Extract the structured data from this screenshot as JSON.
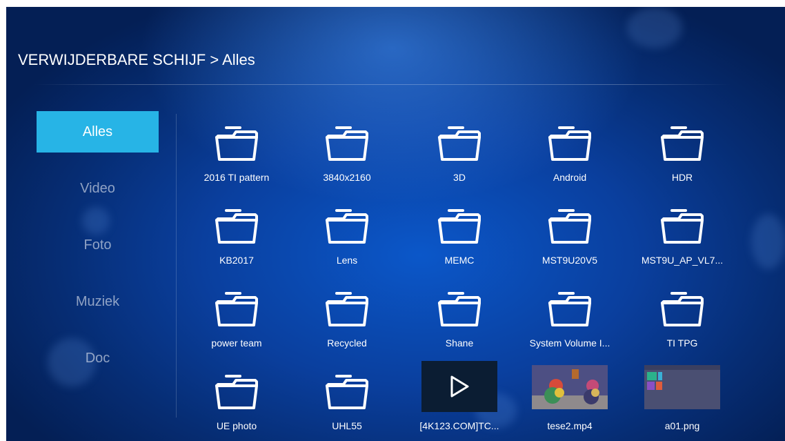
{
  "breadcrumb": {
    "source": "VERWIJDERBARE SCHIJF",
    "separator": ">",
    "current": "Alles"
  },
  "sidebar": {
    "items": [
      {
        "label": "Alles",
        "active": true
      },
      {
        "label": "Video",
        "active": false
      },
      {
        "label": "Foto",
        "active": false
      },
      {
        "label": "Muziek",
        "active": false
      },
      {
        "label": "Doc",
        "active": false
      }
    ]
  },
  "files": [
    {
      "name": "2016 TI pattern",
      "kind": "folder"
    },
    {
      "name": "3840x2160",
      "kind": "folder"
    },
    {
      "name": "3D",
      "kind": "folder"
    },
    {
      "name": "Android",
      "kind": "folder"
    },
    {
      "name": "HDR",
      "kind": "folder"
    },
    {
      "name": "KB2017",
      "kind": "folder"
    },
    {
      "name": "Lens",
      "kind": "folder"
    },
    {
      "name": "MEMC",
      "kind": "folder"
    },
    {
      "name": "MST9U20V5",
      "kind": "folder"
    },
    {
      "name": "MST9U_AP_VL7...",
      "kind": "folder"
    },
    {
      "name": "power team",
      "kind": "folder"
    },
    {
      "name": "Recycled",
      "kind": "folder"
    },
    {
      "name": "Shane",
      "kind": "folder"
    },
    {
      "name": "System Volume I...",
      "kind": "folder"
    },
    {
      "name": "TI TPG",
      "kind": "folder"
    },
    {
      "name": "UE photo",
      "kind": "folder"
    },
    {
      "name": "UHL55",
      "kind": "folder"
    },
    {
      "name": "[4K123.COM]TC...",
      "kind": "video"
    },
    {
      "name": "tese2.mp4",
      "kind": "video-thumbnail"
    },
    {
      "name": "a01.png",
      "kind": "image-thumbnail"
    }
  ],
  "icons": {
    "folder": "folder-icon",
    "play": "play-icon"
  },
  "colors": {
    "accent": "#27b4e6",
    "background": "#0a3f9e",
    "text": "#ffffff"
  }
}
